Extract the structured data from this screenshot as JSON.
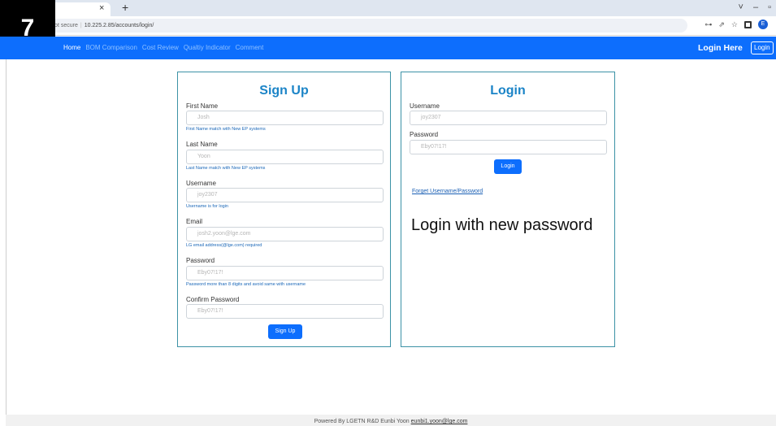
{
  "step_badge": "7",
  "browser": {
    "tab_close": "×",
    "new_tab": "+",
    "window_buttons": [
      "˅",
      "–",
      "▫",
      "×"
    ],
    "security_text": "Not secure",
    "url": "10.225.2.85/accounts/login/",
    "profile_letter": "E"
  },
  "navbar": {
    "links": [
      "Home",
      "BOM Comparison",
      "Cost Review",
      "Qualtiy Indicator",
      "Comment"
    ],
    "active_index": 0,
    "login_here": "Login Here",
    "login_button": "Login",
    "color": "#0d6efd"
  },
  "signup": {
    "title": "Sign Up",
    "fields": [
      {
        "label": "First Name",
        "placeholder": "Josh",
        "hint": "First Name match with New EP systems"
      },
      {
        "label": "Last Name",
        "placeholder": "Yoon",
        "hint": "Last Name match with New EP systems"
      },
      {
        "label": "Username",
        "placeholder": "joy2307",
        "hint": "Username is for login"
      },
      {
        "label": "Email",
        "placeholder": "josh2.yoon@lge.com",
        "hint": "LG email address(@lge.com) required"
      },
      {
        "label": "Password",
        "placeholder": "Eby07!17!",
        "hint": "Password more than 8 digits and avoid same with username"
      },
      {
        "label": "Confirm Password",
        "placeholder": "Eby07!17!",
        "hint": ""
      }
    ],
    "button": "Sign Up"
  },
  "login": {
    "title": "Login",
    "fields": [
      {
        "label": "Username",
        "placeholder": "joy2307"
      },
      {
        "label": "Password",
        "placeholder": "Eby07!17!"
      }
    ],
    "button": "Login",
    "forgot_link": "Forget Username/Password",
    "annotation": "Login with new password"
  },
  "footer": {
    "text": "Powered By LGETN R&D Eunbi Yoon",
    "email": "eunbi1.yoon@lge.com"
  }
}
